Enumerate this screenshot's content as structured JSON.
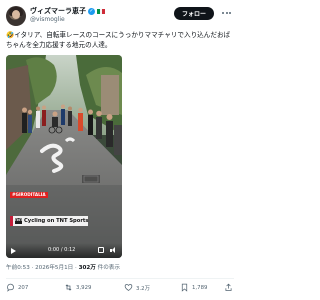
{
  "author": {
    "name": "ヴィズマーラ恵子",
    "handle": "@vismoglie",
    "verified": true,
    "flag_colors": [
      "#009246",
      "#ffffff",
      "#ce2b37"
    ]
  },
  "follow_label": "フォロー",
  "tweet_text": "🤣イタリア、自転車レースのコースにうっかりママチャリで入り込んだおばちゃんを全力応援する地元の人達。",
  "video": {
    "hashtag": "#GIRODITALIA",
    "banner_logo": "TNT",
    "banner_text": "Cycling on TNT Sports",
    "time": "0:00 / 0:12"
  },
  "meta": {
    "time_date": "午前0:53 · 2026年5月1日 · ",
    "views_count": "302万",
    "views_label": " 件の表示"
  },
  "actions": {
    "replies": "207",
    "reposts": "3,929",
    "likes": "3.2万",
    "bookmarks": "1,789"
  },
  "colors": {
    "accent": "#1d9bf0",
    "text": "#0f1419",
    "secondary": "#536471"
  }
}
